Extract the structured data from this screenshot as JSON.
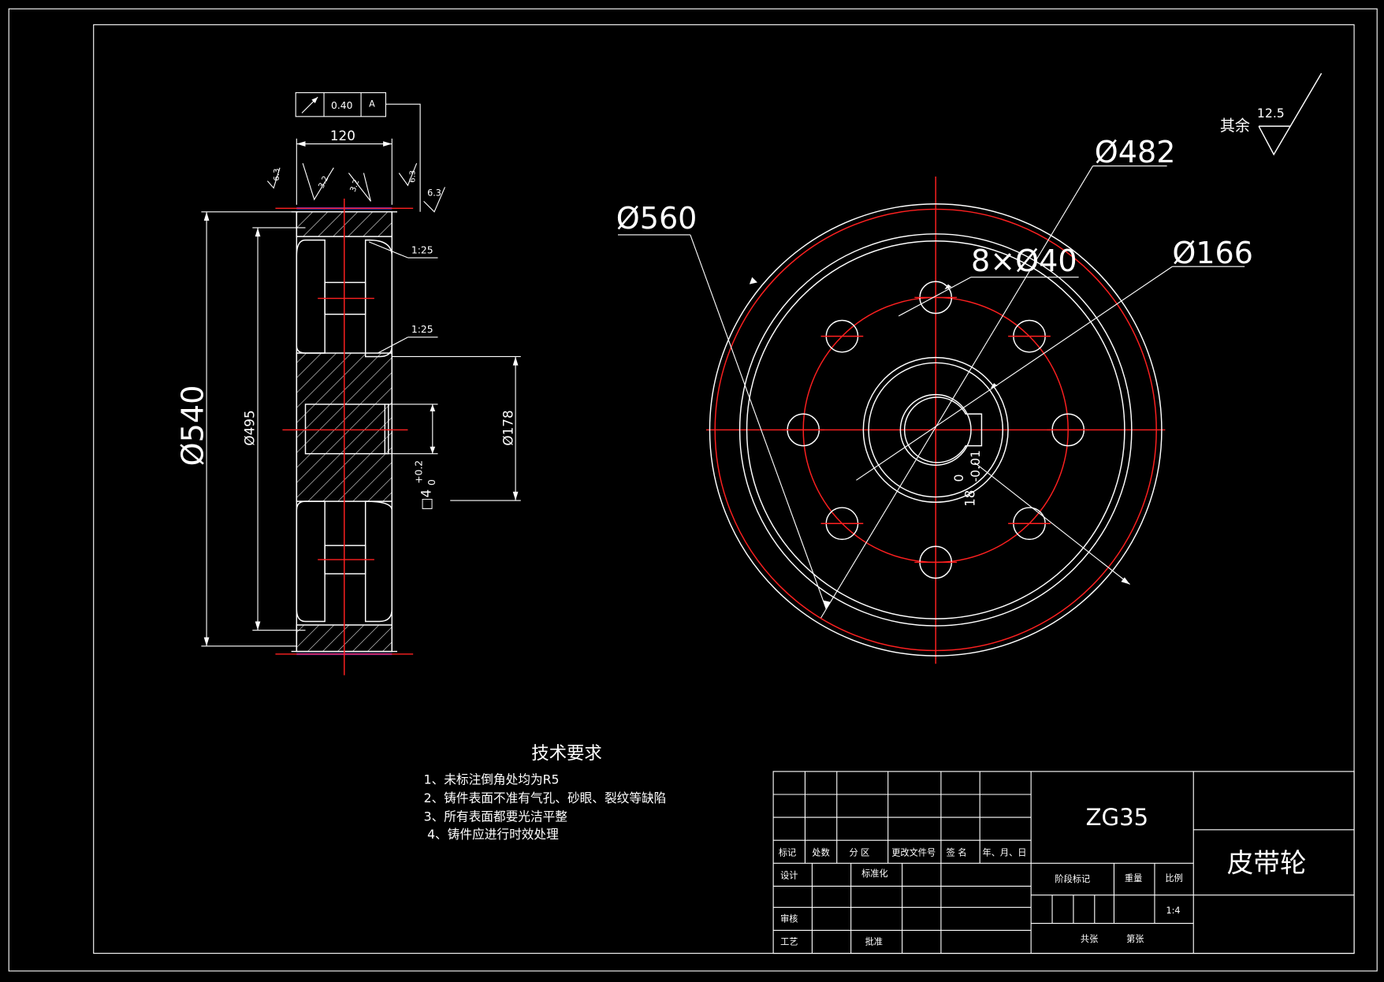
{
  "side_view": {
    "tolerance_value": "0.40",
    "tolerance_datum": "A",
    "width_dim": "120",
    "rough_a": "6.3",
    "rough_b": "3.2",
    "rough_c": "3.2",
    "rough_d": "6.3",
    "rough_e": "6.3",
    "taper_top": "1:25",
    "taper_mid": "1:25",
    "dia_540": "Ø540",
    "dia_495": "Ø495",
    "dia_178": "Ø178",
    "key_width": "□4",
    "key_tol_upper": "+0.2",
    "key_tol_lower": "0"
  },
  "front_view": {
    "dia_560": "Ø560",
    "dia_482": "Ø482",
    "holes": "8×Ø40",
    "dia_166": "Ø166",
    "key_depth": "18",
    "key_tol_upper": "0",
    "key_tol_lower": "-0.01"
  },
  "roughness_note": {
    "label": "其余",
    "value": "12.5"
  },
  "tech_requirements": {
    "title": "技术要求",
    "items": [
      "1、未标注倒角处均为R5",
      "2、铸件表面不准有气孔、砂眼、裂纹等缺陷",
      "3、所有表面都要光洁平整",
      "4、铸件应进行时效处理"
    ]
  },
  "title_block": {
    "material": "ZG35",
    "part_name": "皮带轮",
    "headers": [
      "标记",
      "处数",
      "分 区",
      "更改文件号",
      "签 名",
      "年、月、日"
    ],
    "design": "设计",
    "standardization": "标准化",
    "stage_mark": "阶段标记",
    "weight": "重量",
    "scale_label": "比例",
    "scale_value": "1:4",
    "review": "审核",
    "process": "工艺",
    "approve": "批准",
    "total_sheets": "共张",
    "sheet_no": "第张"
  },
  "colors": {
    "background": "#000000",
    "line": "#ffffff",
    "center_line": "#ff2020",
    "thread": "#3a3aff"
  }
}
